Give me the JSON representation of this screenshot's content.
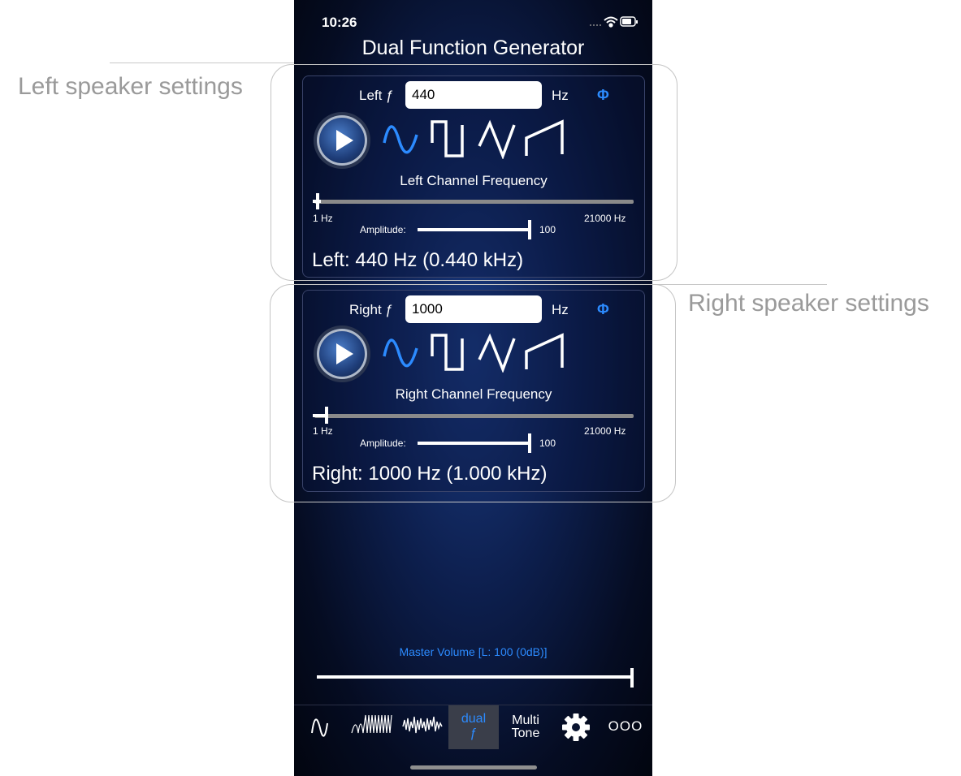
{
  "callouts": {
    "left": "Left speaker settings",
    "right": "Right speaker settings"
  },
  "status": {
    "time": "10:26"
  },
  "app": {
    "title": "Dual Function Generator"
  },
  "left": {
    "label": "Left ƒ",
    "freq_value": "440",
    "unit": "Hz",
    "phase": "Φ",
    "channel_label": "Left Channel Frequency",
    "min_label": "1 Hz",
    "max_label": "21000 Hz",
    "amp_label": "Amplitude:",
    "amp_value": "100",
    "readout": "Left: 440 Hz (0.440 kHz)",
    "selected_wave": "sine",
    "freq_slider_hz": 440
  },
  "right": {
    "label": "Right ƒ",
    "freq_value": "1000",
    "unit": "Hz",
    "phase": "Φ",
    "channel_label": "Right Channel Frequency",
    "min_label": "1 Hz",
    "max_label": "21000 Hz",
    "amp_label": "Amplitude:",
    "amp_value": "100",
    "readout": "Right: 1000 Hz (1.000 kHz)",
    "selected_wave": "sine",
    "freq_slider_hz": 1000
  },
  "master": {
    "label": "Master Volume [L: 100 (0dB)]",
    "level": 1.0
  },
  "tabs": {
    "dual_line1": "dual",
    "dual_line2": "ƒ",
    "multi_line1": "Multi",
    "multi_line2": "Tone",
    "more": "OOO",
    "selected": "dual"
  },
  "colors": {
    "accent": "#2c8bff",
    "callout": "#9a9a9a",
    "panel_border": "#39436a"
  },
  "icons": [
    "sine-tab-icon",
    "sweep-tab-icon",
    "noise-tab-icon",
    "gear-icon",
    "play-icon",
    "sine-wave-icon",
    "square-wave-icon",
    "triangle-wave-icon",
    "sawtooth-wave-icon"
  ]
}
